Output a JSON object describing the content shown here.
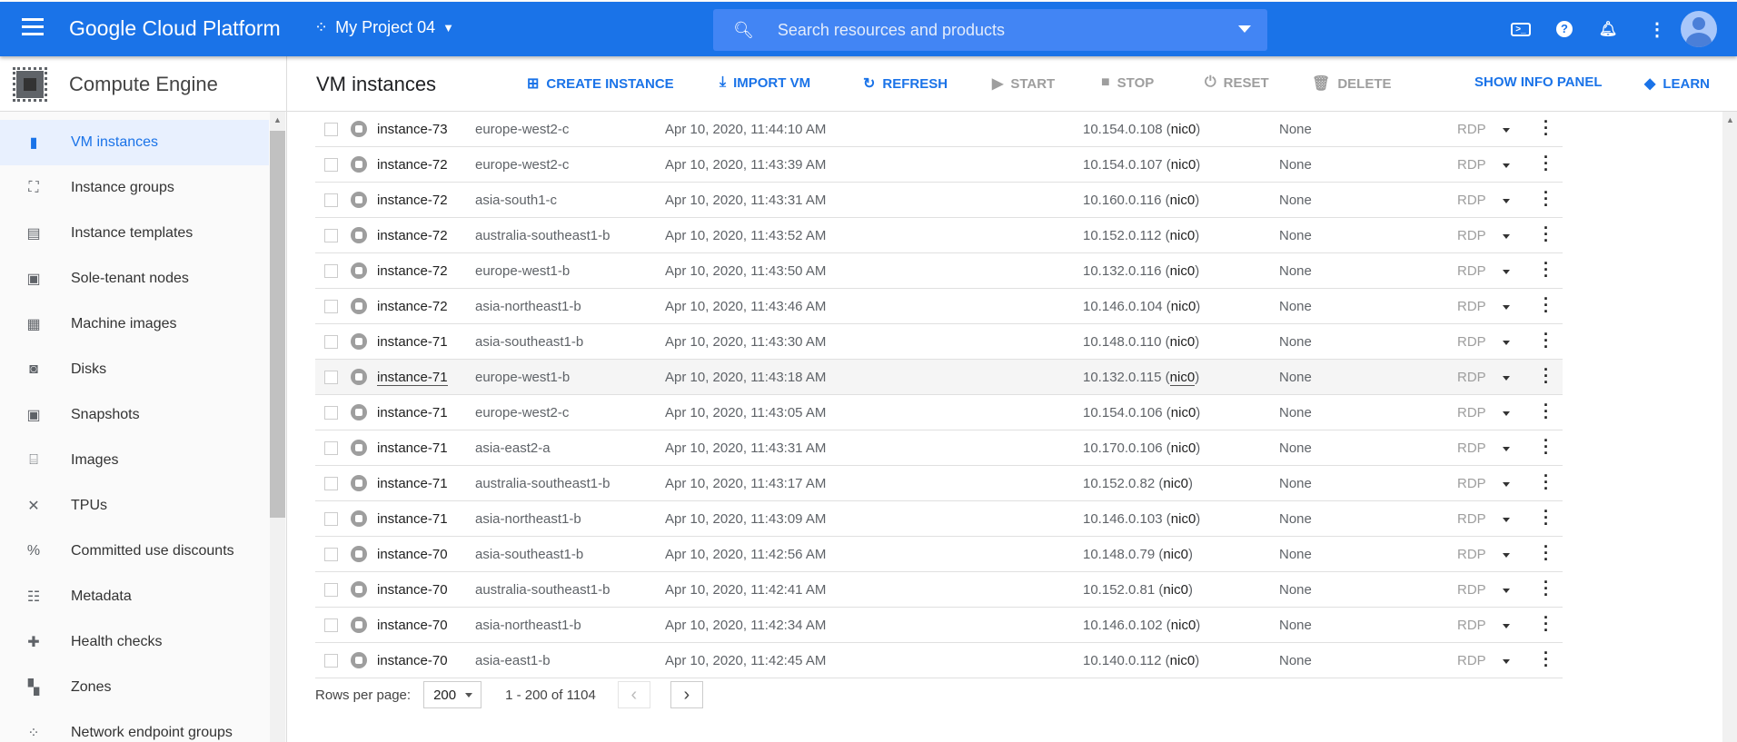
{
  "header": {
    "app_title": "Google Cloud Platform",
    "project": "My Project 04",
    "search_placeholder": "Search resources and products"
  },
  "product": {
    "name": "Compute Engine"
  },
  "toolbar": {
    "title": "VM instances",
    "create": "CREATE INSTANCE",
    "import": "IMPORT VM",
    "refresh": "REFRESH",
    "start": "START",
    "stop": "STOP",
    "reset": "RESET",
    "delete": "DELETE",
    "info": "SHOW INFO PANEL",
    "learn": "LEARN"
  },
  "sidebar": {
    "items": [
      {
        "label": "VM instances",
        "icon": "vm-icon",
        "glyph": "▮",
        "active": true
      },
      {
        "label": "Instance groups",
        "icon": "instance-groups-icon",
        "glyph": "⛶"
      },
      {
        "label": "Instance templates",
        "icon": "instance-templates-icon",
        "glyph": "▤"
      },
      {
        "label": "Sole-tenant nodes",
        "icon": "sole-tenant-icon",
        "glyph": "▣"
      },
      {
        "label": "Machine images",
        "icon": "machine-images-icon",
        "glyph": "▦"
      },
      {
        "label": "Disks",
        "icon": "disk-icon",
        "glyph": "◙"
      },
      {
        "label": "Snapshots",
        "icon": "snapshot-icon",
        "glyph": "▣"
      },
      {
        "label": "Images",
        "icon": "images-icon",
        "glyph": "⌸"
      },
      {
        "label": "TPUs",
        "icon": "tpu-icon",
        "glyph": "✕"
      },
      {
        "label": "Committed use discounts",
        "icon": "percent-icon",
        "glyph": "%"
      },
      {
        "label": "Metadata",
        "icon": "metadata-icon",
        "glyph": "☷"
      },
      {
        "label": "Health checks",
        "icon": "health-icon",
        "glyph": "✚"
      },
      {
        "label": "Zones",
        "icon": "zones-icon",
        "glyph": "▚"
      },
      {
        "label": "Network endpoint groups",
        "icon": "network-endpoint-icon",
        "glyph": "⁘"
      }
    ]
  },
  "table": {
    "connect_label": "RDP",
    "rows": [
      {
        "name": "instance-73",
        "zone": "europe-west2-c",
        "created": "Apr 10, 2020, 11:44:10 AM",
        "ip": "10.154.0.108",
        "nic": "nic0",
        "external": "None"
      },
      {
        "name": "instance-72",
        "zone": "europe-west2-c",
        "created": "Apr 10, 2020, 11:43:39 AM",
        "ip": "10.154.0.107",
        "nic": "nic0",
        "external": "None"
      },
      {
        "name": "instance-72",
        "zone": "asia-south1-c",
        "created": "Apr 10, 2020, 11:43:31 AM",
        "ip": "10.160.0.116",
        "nic": "nic0",
        "external": "None"
      },
      {
        "name": "instance-72",
        "zone": "australia-southeast1-b",
        "created": "Apr 10, 2020, 11:43:52 AM",
        "ip": "10.152.0.112",
        "nic": "nic0",
        "external": "None"
      },
      {
        "name": "instance-72",
        "zone": "europe-west1-b",
        "created": "Apr 10, 2020, 11:43:50 AM",
        "ip": "10.132.0.116",
        "nic": "nic0",
        "external": "None"
      },
      {
        "name": "instance-72",
        "zone": "asia-northeast1-b",
        "created": "Apr 10, 2020, 11:43:46 AM",
        "ip": "10.146.0.104",
        "nic": "nic0",
        "external": "None"
      },
      {
        "name": "instance-71",
        "zone": "asia-southeast1-b",
        "created": "Apr 10, 2020, 11:43:30 AM",
        "ip": "10.148.0.110",
        "nic": "nic0",
        "external": "None"
      },
      {
        "name": "instance-71",
        "zone": "europe-west1-b",
        "created": "Apr 10, 2020, 11:43:18 AM",
        "ip": "10.132.0.115",
        "nic": "nic0",
        "external": "None",
        "hover": true
      },
      {
        "name": "instance-71",
        "zone": "europe-west2-c",
        "created": "Apr 10, 2020, 11:43:05 AM",
        "ip": "10.154.0.106",
        "nic": "nic0",
        "external": "None"
      },
      {
        "name": "instance-71",
        "zone": "asia-east2-a",
        "created": "Apr 10, 2020, 11:43:31 AM",
        "ip": "10.170.0.106",
        "nic": "nic0",
        "external": "None"
      },
      {
        "name": "instance-71",
        "zone": "australia-southeast1-b",
        "created": "Apr 10, 2020, 11:43:17 AM",
        "ip": "10.152.0.82",
        "nic": "nic0",
        "external": "None"
      },
      {
        "name": "instance-71",
        "zone": "asia-northeast1-b",
        "created": "Apr 10, 2020, 11:43:09 AM",
        "ip": "10.146.0.103",
        "nic": "nic0",
        "external": "None"
      },
      {
        "name": "instance-70",
        "zone": "asia-southeast1-b",
        "created": "Apr 10, 2020, 11:42:56 AM",
        "ip": "10.148.0.79",
        "nic": "nic0",
        "external": "None"
      },
      {
        "name": "instance-70",
        "zone": "australia-southeast1-b",
        "created": "Apr 10, 2020, 11:42:41 AM",
        "ip": "10.152.0.81",
        "nic": "nic0",
        "external": "None"
      },
      {
        "name": "instance-70",
        "zone": "asia-northeast1-b",
        "created": "Apr 10, 2020, 11:42:34 AM",
        "ip": "10.146.0.102",
        "nic": "nic0",
        "external": "None"
      },
      {
        "name": "instance-70",
        "zone": "asia-east1-b",
        "created": "Apr 10, 2020, 11:42:45 AM",
        "ip": "10.140.0.112",
        "nic": "nic0",
        "external": "None"
      }
    ]
  },
  "pagination": {
    "rows_label": "Rows per page:",
    "rows_value": "200",
    "range": "1 - 200 of 1104"
  },
  "colors": {
    "brand": "#1a73e8",
    "search": "#4285f4"
  }
}
